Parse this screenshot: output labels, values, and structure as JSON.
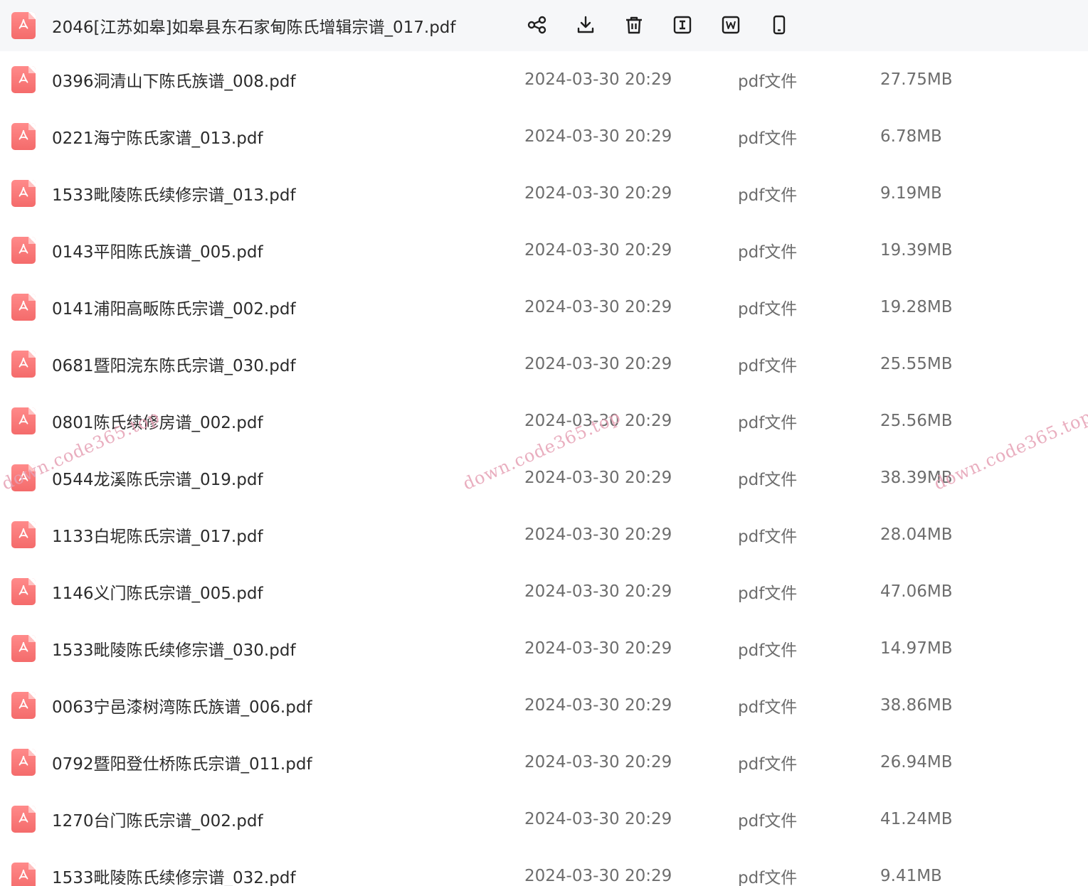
{
  "selected_file": {
    "name": "2046[江苏如皋]如皋县东石家甸陈氏增辑宗谱_017.pdf",
    "actions": [
      {
        "name": "share-button",
        "icon": "share-icon"
      },
      {
        "name": "download-button",
        "icon": "download-icon"
      },
      {
        "name": "delete-button",
        "icon": "trash-icon"
      },
      {
        "name": "rename-button",
        "icon": "text-cursor-icon"
      },
      {
        "name": "convert-word-button",
        "icon": "word-doc-icon"
      },
      {
        "name": "mobile-button",
        "icon": "phone-icon"
      }
    ]
  },
  "files": [
    {
      "name": "0396洞清山下陈氏族谱_008.pdf",
      "date": "2024-03-30 20:29",
      "type": "pdf文件",
      "size": "27.75MB"
    },
    {
      "name": "0221海宁陈氏家谱_013.pdf",
      "date": "2024-03-30 20:29",
      "type": "pdf文件",
      "size": "6.78MB"
    },
    {
      "name": "1533毗陵陈氏续修宗谱_013.pdf",
      "date": "2024-03-30 20:29",
      "type": "pdf文件",
      "size": "9.19MB"
    },
    {
      "name": "0143平阳陈氏族谱_005.pdf",
      "date": "2024-03-30 20:29",
      "type": "pdf文件",
      "size": "19.39MB"
    },
    {
      "name": "0141浦阳高畈陈氏宗谱_002.pdf",
      "date": "2024-03-30 20:29",
      "type": "pdf文件",
      "size": "19.28MB"
    },
    {
      "name": "0681暨阳浣东陈氏宗谱_030.pdf",
      "date": "2024-03-30 20:29",
      "type": "pdf文件",
      "size": "25.55MB"
    },
    {
      "name": "0801陈氏续修房谱_002.pdf",
      "date": "2024-03-30 20:29",
      "type": "pdf文件",
      "size": "25.56MB"
    },
    {
      "name": "0544龙溪陈氏宗谱_019.pdf",
      "date": "2024-03-30 20:29",
      "type": "pdf文件",
      "size": "38.39MB"
    },
    {
      "name": "1133白坭陈氏宗谱_017.pdf",
      "date": "2024-03-30 20:29",
      "type": "pdf文件",
      "size": "28.04MB"
    },
    {
      "name": "1146义门陈氏宗谱_005.pdf",
      "date": "2024-03-30 20:29",
      "type": "pdf文件",
      "size": "47.06MB"
    },
    {
      "name": "1533毗陵陈氏续修宗谱_030.pdf",
      "date": "2024-03-30 20:29",
      "type": "pdf文件",
      "size": "14.97MB"
    },
    {
      "name": "0063宁邑漆树湾陈氏族谱_006.pdf",
      "date": "2024-03-30 20:29",
      "type": "pdf文件",
      "size": "38.86MB"
    },
    {
      "name": "0792暨阳登仕桥陈氏宗谱_011.pdf",
      "date": "2024-03-30 20:29",
      "type": "pdf文件",
      "size": "26.94MB"
    },
    {
      "name": "1270台门陈氏宗谱_002.pdf",
      "date": "2024-03-30 20:29",
      "type": "pdf文件",
      "size": "41.24MB"
    },
    {
      "name": "1533毗陵陈氏续修宗谱_032.pdf",
      "date": "2024-03-30 20:29",
      "type": "pdf文件",
      "size": "9.41MB"
    }
  ],
  "watermark_text": "down.code365.top",
  "colors": {
    "pdf_icon": "#f46b6b",
    "selected_row_bg": "#f6f7f9",
    "name_text": "#2b2b2b",
    "meta_text": "#6d6d6d",
    "watermark": "#e6a0b4"
  }
}
